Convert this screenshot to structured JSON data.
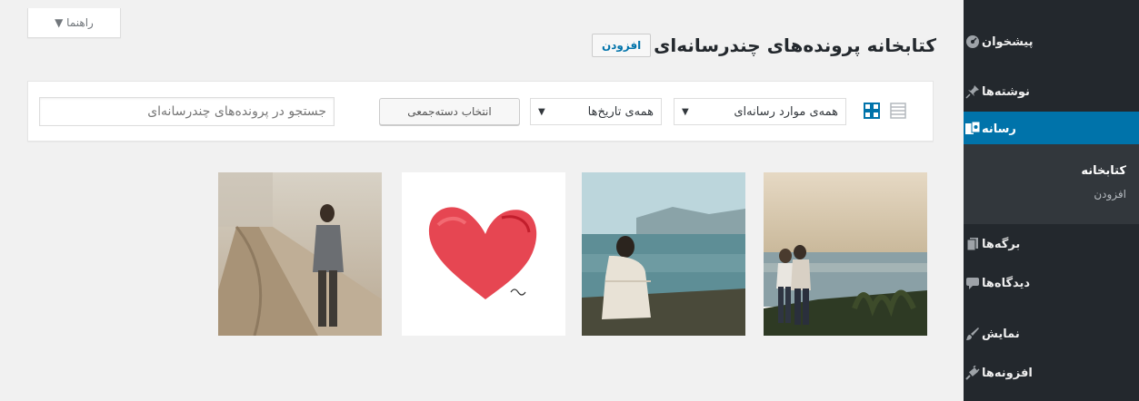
{
  "help_tab": {
    "label": "راهنما ▼"
  },
  "header": {
    "title": "کتابخانه پرونده‌های چندرسانه‌ای",
    "add_new_label": "افزودن"
  },
  "toolbar": {
    "search_placeholder": "جستجو در پرونده‌های چندرسانه‌ای",
    "bulk_select_label": "انتخاب دسته‌جمعی",
    "date_filter": "همه‌ی تاریخ‌ها",
    "type_filter": "همه‌ی موارد رسانه‌ای",
    "arrow": "▼",
    "view_modes": [
      "grid-view-icon",
      "list-view-icon"
    ]
  },
  "sidebar": {
    "items": [
      {
        "label": "پیشخوان",
        "icon": "dashboard-icon"
      },
      {
        "label": "نوشته‌ها",
        "icon": "pin-icon"
      },
      {
        "label": "رسانه",
        "icon": "media-icon",
        "current": true
      },
      {
        "label": "برگه‌ها",
        "icon": "pages-icon"
      },
      {
        "label": "دیدگاه‌ها",
        "icon": "comments-icon"
      },
      {
        "label": "نمایش",
        "icon": "appearance-icon"
      },
      {
        "label": "افزونه‌ها",
        "icon": "plugins-icon"
      }
    ],
    "submenu": [
      {
        "label": "کتابخانه",
        "active": true
      },
      {
        "label": "افزودن",
        "active": false
      }
    ]
  },
  "media": [
    {
      "subject": "couple-by-sea-photo"
    },
    {
      "subject": "woman-sitting-by-lake-photo"
    },
    {
      "subject": "red-heart-drawing"
    },
    {
      "subject": "man-on-dirt-road-photo"
    }
  ],
  "colors": {
    "sidebar": "#23282d",
    "submenu": "#32373c",
    "accent": "#0073aa",
    "background": "#f1f1f1"
  }
}
